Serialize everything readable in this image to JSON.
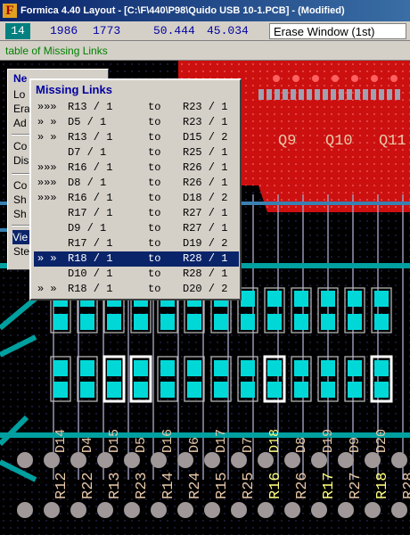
{
  "window": {
    "title": "Formica 4.40 Layout - [C:\\F\\440\\P98\\Quido USB 10-1.PCB] - (Modified)",
    "icon": "formica-app-icon"
  },
  "status": {
    "layer": "14",
    "x1": "1986",
    "y1": "1773",
    "x2": "50.444",
    "y2": "45.034",
    "mode": "Erase Window (1st)"
  },
  "hint": "table of Missing Links",
  "colors": {
    "board_bg": "#000000",
    "copper_top": "#cc1010",
    "copper_bottom": "#00a0a0",
    "pad": "#00d8d8",
    "silk": "#e8c8a8",
    "highlight": "#0a246a"
  },
  "context_menu": {
    "items": [
      {
        "label": "Ne",
        "kind": "header"
      },
      {
        "label": "Lo",
        "kind": "item"
      },
      {
        "label": "Era",
        "kind": "item"
      },
      {
        "label": "Ad",
        "kind": "item"
      },
      {
        "label": "Co",
        "kind": "item"
      },
      {
        "label": "Dis",
        "kind": "item"
      },
      {
        "label": "Co",
        "kind": "item"
      },
      {
        "label": "Sh",
        "kind": "item"
      },
      {
        "label": "Sh",
        "kind": "item"
      },
      {
        "label": "Vie",
        "kind": "selected"
      },
      {
        "label": "Ste",
        "kind": "item"
      }
    ]
  },
  "missing_links": {
    "title": "Missing Links",
    "connector": "to",
    "rows": [
      {
        "mark": "»»»",
        "from": "R13 / 1",
        "to": "R23 / 1"
      },
      {
        "mark": "» »",
        "from": "D5 / 1",
        "to": "R23 / 1"
      },
      {
        "mark": "» »",
        "from": "R13 / 1",
        "to": "D15 / 2"
      },
      {
        "mark": "",
        "from": "D7 / 1",
        "to": "R25 / 1"
      },
      {
        "mark": "»»»",
        "from": "R16 / 1",
        "to": "R26 / 1"
      },
      {
        "mark": "»»»",
        "from": "D8 / 1",
        "to": "R26 / 1"
      },
      {
        "mark": "»»»",
        "from": "R16 / 1",
        "to": "D18 / 2"
      },
      {
        "mark": "",
        "from": "R17 / 1",
        "to": "R27 / 1"
      },
      {
        "mark": "",
        "from": "D9 / 1",
        "to": "R27 / 1"
      },
      {
        "mark": "",
        "from": "R17 / 1",
        "to": "D19 / 2"
      },
      {
        "mark": "» »",
        "from": "R18 / 1",
        "to": "R28 / 1",
        "selected": true
      },
      {
        "mark": "",
        "from": "D10 / 1",
        "to": "R28 / 1"
      },
      {
        "mark": "» »",
        "from": "R18 / 1",
        "to": "D20 / 2"
      }
    ]
  },
  "board": {
    "transistor_labels": [
      "Q9",
      "Q10",
      "Q11"
    ],
    "diode_labels": [
      "D14",
      "D4",
      "D15",
      "D5",
      "D16",
      "D6",
      "D17",
      "D7",
      "D18",
      "D8",
      "D19",
      "D9",
      "D20"
    ],
    "resistor_labels": [
      "R12",
      "R22",
      "R13",
      "R23",
      "R14",
      "R24",
      "R15",
      "R25",
      "R16",
      "R26",
      "R17",
      "R27",
      "R18",
      "R28"
    ]
  }
}
